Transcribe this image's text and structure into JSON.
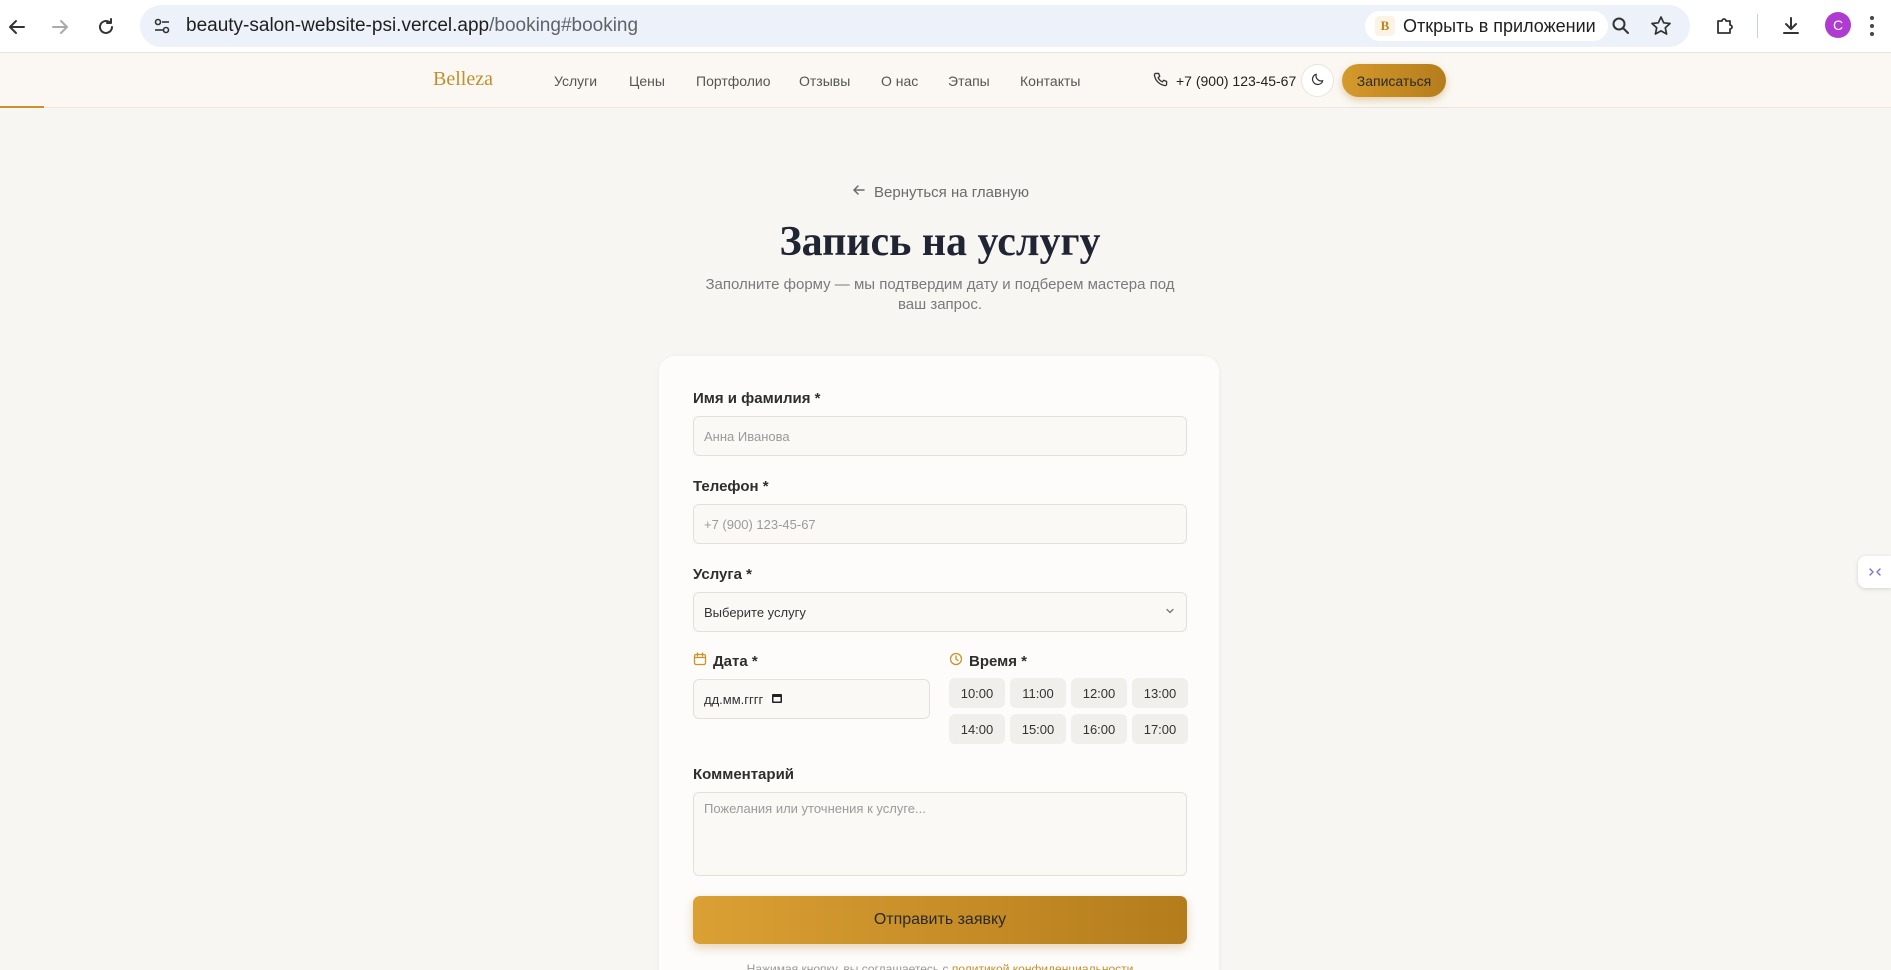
{
  "browser": {
    "url_host": "beauty-salon-website-psi.vercel.app",
    "url_path": "/booking#booking",
    "open_app_badge": "B",
    "open_app_label": "Открыть в приложении",
    "profile_initial": "С"
  },
  "site": {
    "logo": "Belleza",
    "nav": [
      {
        "label": "Услуги"
      },
      {
        "label": "Цены"
      },
      {
        "label": "Портфолио"
      },
      {
        "label": "Отзывы"
      },
      {
        "label": "О нас"
      },
      {
        "label": "Этапы"
      },
      {
        "label": "Контакты"
      }
    ],
    "phone": "+7 (900) 123-45-67",
    "cta": "Записаться",
    "accent": "#c9932a"
  },
  "page": {
    "back_link": "Вернуться на главную",
    "title": "Запись на услугу",
    "subtitle": "Заполните форму — мы подтвердим дату и подберем мастера под ваш запрос."
  },
  "form": {
    "name": {
      "label": "Имя и фамилия *",
      "placeholder": "Анна Иванова"
    },
    "phone": {
      "label": "Телефон *",
      "placeholder": "+7 (900) 123-45-67"
    },
    "service": {
      "label": "Услуга *",
      "selected": "Выберите услугу"
    },
    "date": {
      "label": "Дата *",
      "placeholder": "дд.мм.гггг"
    },
    "time": {
      "label": "Время *",
      "slots": [
        "10:00",
        "11:00",
        "12:00",
        "13:00",
        "14:00",
        "15:00",
        "16:00",
        "17:00"
      ]
    },
    "comment": {
      "label": "Комментарий",
      "placeholder": "Пожелания или уточнения к услуге..."
    },
    "submit": "Отправить заявку",
    "consent_text": "Нажимая кнопку, вы соглашаетесь с ",
    "consent_link": "политикой конфиденциальности"
  }
}
